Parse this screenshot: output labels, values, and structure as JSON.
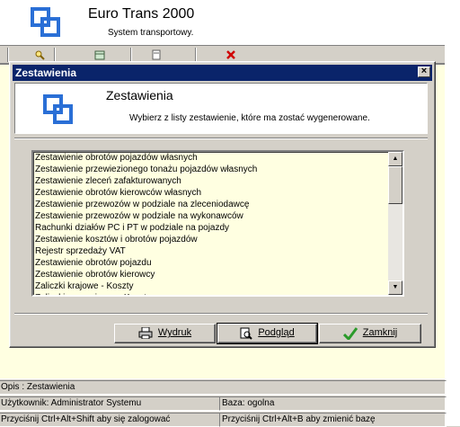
{
  "app": {
    "title": "Euro Trans 2000",
    "subtitle": "System transportowy."
  },
  "statusbar": {
    "description": "Opis : Zestawienia",
    "user": "Użytkownik: Administrator Systemu",
    "database": "Baza: ogolna",
    "login_hint": "Przyciśnij Ctrl+Alt+Shift aby się zalogować",
    "change_db_hint": "Przyciśnij Ctrl+Alt+B aby zmienić bazę"
  },
  "dialog": {
    "title": "Zestawienia",
    "close_label": "×",
    "heading": "Zestawienia",
    "description": "Wybierz z listy zestawienie, które ma zostać wygenerowane.",
    "items": [
      "Zestawienie obrotów pojazdów własnych",
      "Zestawienie przewiezionego tonażu pojazdów własnych",
      "Zestawienie zleceń zafakturowanych",
      "Zestawienie obrotów kierowców własnych",
      "Zestawienie przewozów w podziale na zleceniodawcę",
      "Zestawienie przewozów w podziale na wykonawców",
      "Rachunki działów PC i PT w podziale na pojazdy",
      "Zestawienie kosztów i obrotów pojazdów",
      "Rejestr sprzedaży VAT",
      "Zestawienie obrotów pojazdu",
      "Zestawienie obrotów kierowcy",
      "Zaliczki krajowe - Koszty",
      "Zaliczki zagraniczne - Koszty"
    ],
    "buttons": {
      "print": "Wydruk",
      "preview": "Podgląd",
      "close": "Zamknij"
    }
  },
  "icons": {
    "logo": "linked-squares-logo-icon",
    "print": "printer-icon",
    "preview": "magnifier-document-icon",
    "close": "green-checkmark-icon",
    "toolbar_delete": "red-x-icon"
  },
  "colors": {
    "titlebar": "#0a246a",
    "logo_blue": "#2a6fd6",
    "list_background": "#ffffe1"
  }
}
